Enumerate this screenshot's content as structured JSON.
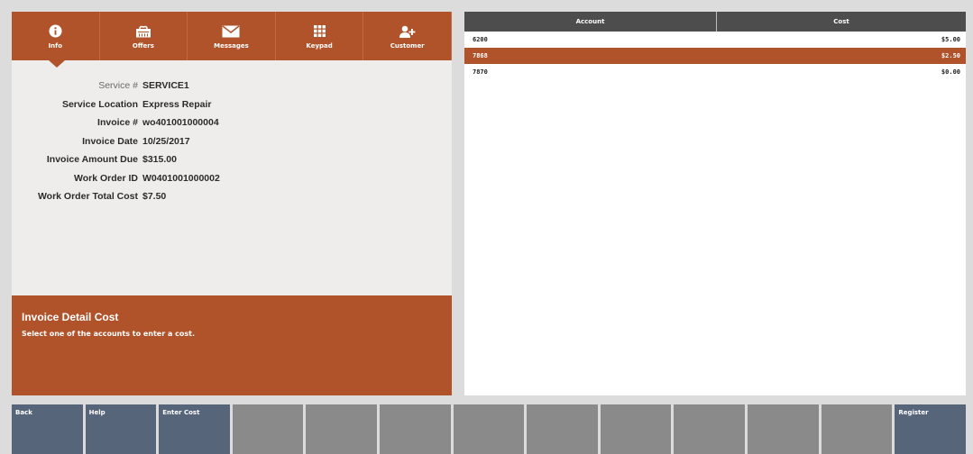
{
  "tabs": [
    {
      "label": "Info",
      "icon": "info-icon"
    },
    {
      "label": "Offers",
      "icon": "offers-icon"
    },
    {
      "label": "Messages",
      "icon": "envelope-icon"
    },
    {
      "label": "Keypad",
      "icon": "keypad-icon"
    },
    {
      "label": "Customer",
      "icon": "add-customer-icon"
    }
  ],
  "details": [
    {
      "label": "Service #",
      "value": "SERVICE1"
    },
    {
      "label": "Service Location",
      "value": "Express Repair"
    },
    {
      "label": "Invoice #",
      "value": "wo401001000004"
    },
    {
      "label": "Invoice Date",
      "value": "10/25/2017"
    },
    {
      "label": "Invoice Amount Due",
      "value": "$315.00"
    },
    {
      "label": "Work Order ID",
      "value": "W0401001000002"
    },
    {
      "label": "Work Order Total Cost",
      "value": "$7.50"
    }
  ],
  "message": {
    "title": "Invoice Detail Cost",
    "text": "Select one of the accounts to enter a cost."
  },
  "table": {
    "headers": {
      "account": "Account",
      "cost": "Cost"
    },
    "rows": [
      {
        "account": "6200",
        "cost": "$5.00",
        "selected": false
      },
      {
        "account": "7868",
        "cost": "$2.50",
        "selected": true
      },
      {
        "account": "7870",
        "cost": "$0.00",
        "selected": false
      }
    ]
  },
  "function_keys": {
    "back": "Back",
    "help": "Help",
    "enter_cost": "Enter Cost",
    "register": "Register"
  },
  "colors": {
    "accent": "#b0532a",
    "table_header": "#4d4d4d",
    "active_key": "#56657a",
    "inactive_key": "#8a8a8a"
  }
}
